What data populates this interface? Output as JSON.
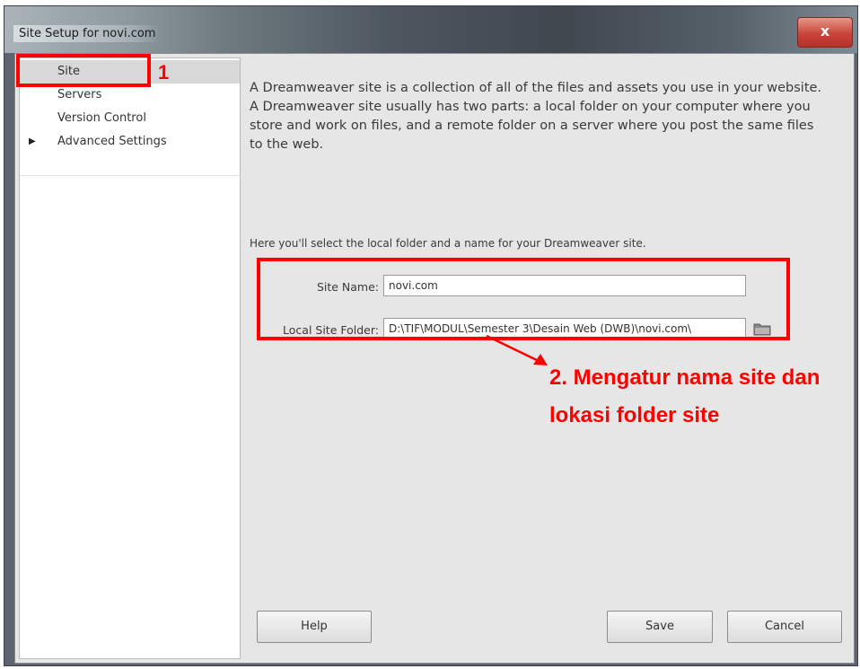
{
  "window": {
    "title": "Site Setup for novi.com",
    "close_glyph": "x"
  },
  "sidebar": {
    "items": [
      {
        "label": "Site",
        "selected": true
      },
      {
        "label": "Servers",
        "selected": false
      },
      {
        "label": "Version Control",
        "selected": false
      },
      {
        "label": "Advanced Settings",
        "selected": false,
        "expandable": true
      }
    ],
    "expand_glyph": "▶"
  },
  "main": {
    "description": "A Dreamweaver site is a collection of all of the files and assets you use in your website. A Dreamweaver site usually has two parts: a local folder on your computer where you store and work on files, and a remote folder on a server where you post the same files to the web.",
    "instruction": "Here you'll select the local folder and a name for your Dreamweaver site.",
    "site_name": {
      "label": "Site Name:",
      "value": "novi.com"
    },
    "local_folder": {
      "label": "Local Site Folder:",
      "value": "D:\\TIF\\MODUL\\Semester 3\\Desain Web (DWB)\\novi.com\\",
      "icon": "folder-icon"
    }
  },
  "buttons": {
    "help": "Help",
    "save": "Save",
    "cancel": "Cancel"
  },
  "annotations": {
    "step1": "1",
    "step2_line1": "2. Mengatur nama site dan",
    "step2_line2": "lokasi folder site",
    "color": "#ff0000"
  }
}
